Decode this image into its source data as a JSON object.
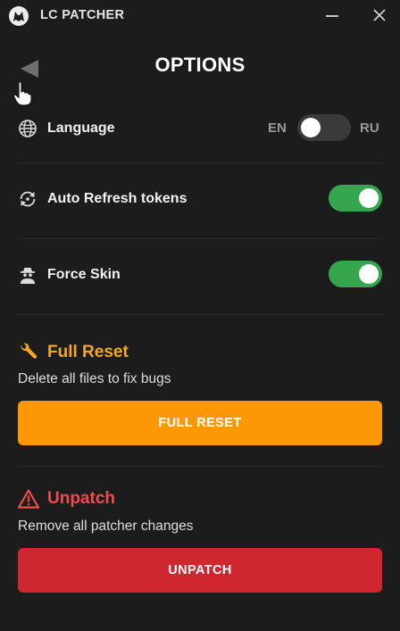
{
  "app": {
    "title": "LC PATCHER"
  },
  "header": {
    "title": "OPTIONS"
  },
  "options": {
    "language": {
      "label": "Language",
      "left_code": "EN",
      "right_code": "RU",
      "selected": "EN"
    },
    "auto_refresh": {
      "label": "Auto Refresh tokens",
      "enabled": true
    },
    "force_skin": {
      "label": "Force Skin",
      "enabled": true
    }
  },
  "full_reset": {
    "title": "Full Reset",
    "description": "Delete all files to fix bugs",
    "button_label": "FULL RESET"
  },
  "unpatch": {
    "title": "Unpatch",
    "description": "Remove all patcher changes",
    "button_label": "UNPATCH"
  },
  "colors": {
    "background": "#1c1c1c",
    "toggle_on": "#35a64e",
    "toggle_off": "#3a3a3a",
    "reset_accent": "#fc9806",
    "reset_title": "#f5a623",
    "unpatch_accent": "#cf2730",
    "unpatch_title": "#ef4b4f"
  },
  "icons": {
    "app_logo": "wolf-logo-icon",
    "minimize": "minimize-icon",
    "close": "close-icon",
    "back": "back-arrow-icon",
    "language": "globe-icon",
    "auto_refresh": "refresh-icon",
    "force_skin": "spy-icon",
    "full_reset": "wrench-icon",
    "unpatch": "warning-icon"
  }
}
